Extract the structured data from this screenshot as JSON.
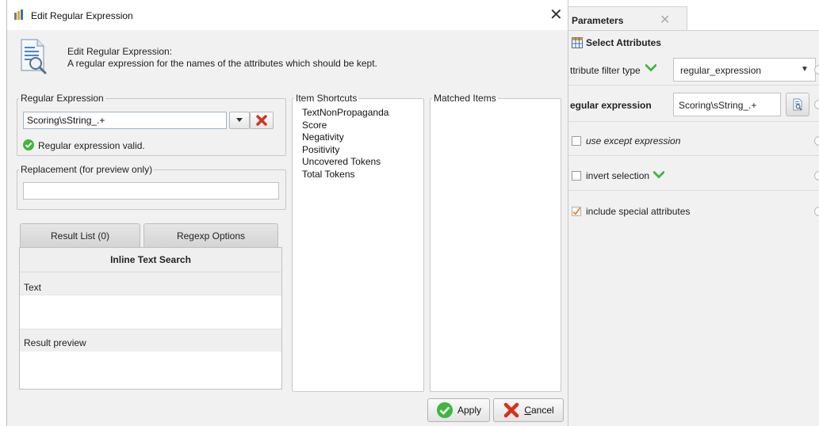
{
  "dialog": {
    "title": "Edit Regular Expression",
    "header_title": "Edit Regular Expression:",
    "header_desc": "A regular expression for the names of the attributes which should be kept.",
    "regex_group_label": "Regular Expression",
    "regex_value": "Scoring\\sString_.+",
    "valid_text": "Regular expression valid.",
    "replacement_group_label": "Replacement (for preview only)",
    "replacement_value": "",
    "tabs": [
      "Result List (0)",
      "Regexp Options"
    ],
    "inline_search_header": "Inline Text Search",
    "text_label": "Text",
    "result_preview_label": "Result preview",
    "shortcuts_label": "Item Shortcuts",
    "shortcuts": [
      "TextNonPropaganda",
      "Score",
      "Negativity",
      "Positivity",
      "Uncovered Tokens",
      "Total Tokens"
    ],
    "matched_label": "Matched Items",
    "matched": [],
    "apply_label": "Apply",
    "cancel_label_first": "C",
    "cancel_label_rest": "ancel"
  },
  "params": {
    "tab_label": "Parameters",
    "operator_name": "Select Attributes",
    "filter_type_label": "ttribute filter type",
    "filter_type_value": "regular_expression",
    "regex_label": "egular expression",
    "regex_value": "Scoring\\sString_.+",
    "use_except_label": "use except expression",
    "use_except_checked": false,
    "invert_label": "invert selection",
    "invert_checked": false,
    "include_special_label": "include special attributes",
    "include_special_checked": true
  },
  "colors": {
    "valid_green": "#3fb63f",
    "clear_red": "#d8301d",
    "check_orange": "#e8821e"
  }
}
